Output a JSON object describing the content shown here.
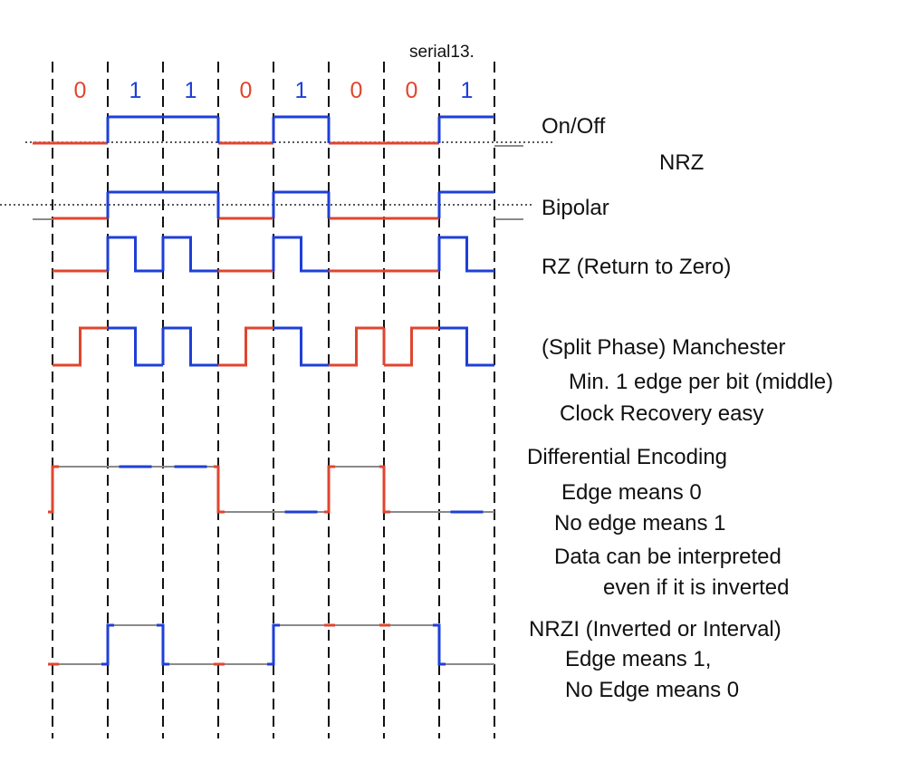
{
  "source_label": "serial13.",
  "bits": [
    "0",
    "1",
    "1",
    "0",
    "1",
    "0",
    "0",
    "1"
  ],
  "colors": {
    "zero": "#e0452f",
    "one": "#1f3fd8",
    "neutral": "#8a8a8a",
    "text": "#111111"
  },
  "labels": {
    "on_off": "On/Off",
    "nrz": "NRZ",
    "bipolar": "Bipolar",
    "rz": "RZ (Return to Zero)",
    "manchester": "(Split Phase) Manchester",
    "manchester_note1": "Min. 1 edge per bit (middle)",
    "manchester_note2": "Clock Recovery easy",
    "diff": "Differential Encoding",
    "diff_note1": "Edge means 0",
    "diff_note2": "No edge means 1",
    "diff_note3": "Data can be interpreted",
    "diff_note4": "even if it is inverted",
    "nrzi": "NRZI (Inverted or Interval)",
    "nrzi_note1": "Edge means 1,",
    "nrzi_note2": "No Edge means 0"
  }
}
